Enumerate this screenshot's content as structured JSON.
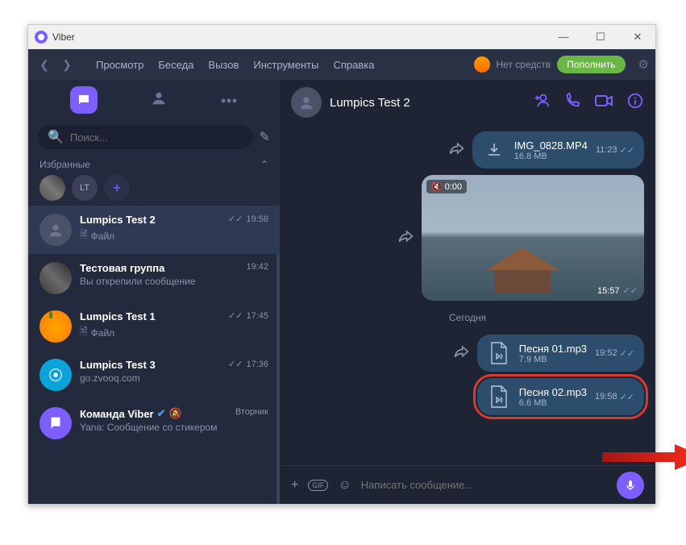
{
  "titlebar": {
    "app": "Viber"
  },
  "menubar": {
    "items": [
      "Просмотр",
      "Беседа",
      "Вызов",
      "Инструменты",
      "Справка"
    ],
    "balance_label": "Нет средств",
    "topup": "Пополнить"
  },
  "sidebar": {
    "search_placeholder": "Поиск...",
    "favorites_label": "Избранные",
    "fav_lt": "LT",
    "chats": [
      {
        "name": "Lumpics Test 2",
        "preview": "Файл",
        "time": "19:58",
        "read": true,
        "selected": true,
        "avatar": "placeholder",
        "doc": true
      },
      {
        "name": "Тестовая группа",
        "preview": "Вы открепили сообщение",
        "time": "19:42",
        "avatar": "img"
      },
      {
        "name": "Lumpics Test 1",
        "preview": "Файл",
        "time": "17:45",
        "read": true,
        "avatar": "orange",
        "doc": true
      },
      {
        "name": "Lumpics Test 3",
        "preview": "go.zvooq.com",
        "time": "17:36",
        "read": true,
        "avatar": "cyan"
      },
      {
        "name": "Команда Viber",
        "preview": "Yana: Сообщение со стикером",
        "time": "Вторник",
        "avatar": "viber",
        "verified": true,
        "muted": true
      }
    ]
  },
  "chat": {
    "title": "Lumpics Test 2",
    "messages": {
      "mp4": {
        "name": "IMG_0828.MP4",
        "size": "16.8 MB",
        "time": "11:23"
      },
      "video": {
        "duration": "0:00",
        "time": "15:57"
      },
      "date": "Сегодня",
      "audio1": {
        "name": "Песня 01.mp3",
        "size": "7.9 MB",
        "time": "19:52"
      },
      "audio2": {
        "name": "Песня 02.mp3",
        "size": "6.6 MB",
        "time": "19:58"
      }
    },
    "composer_placeholder": "Написать сообщение..."
  }
}
